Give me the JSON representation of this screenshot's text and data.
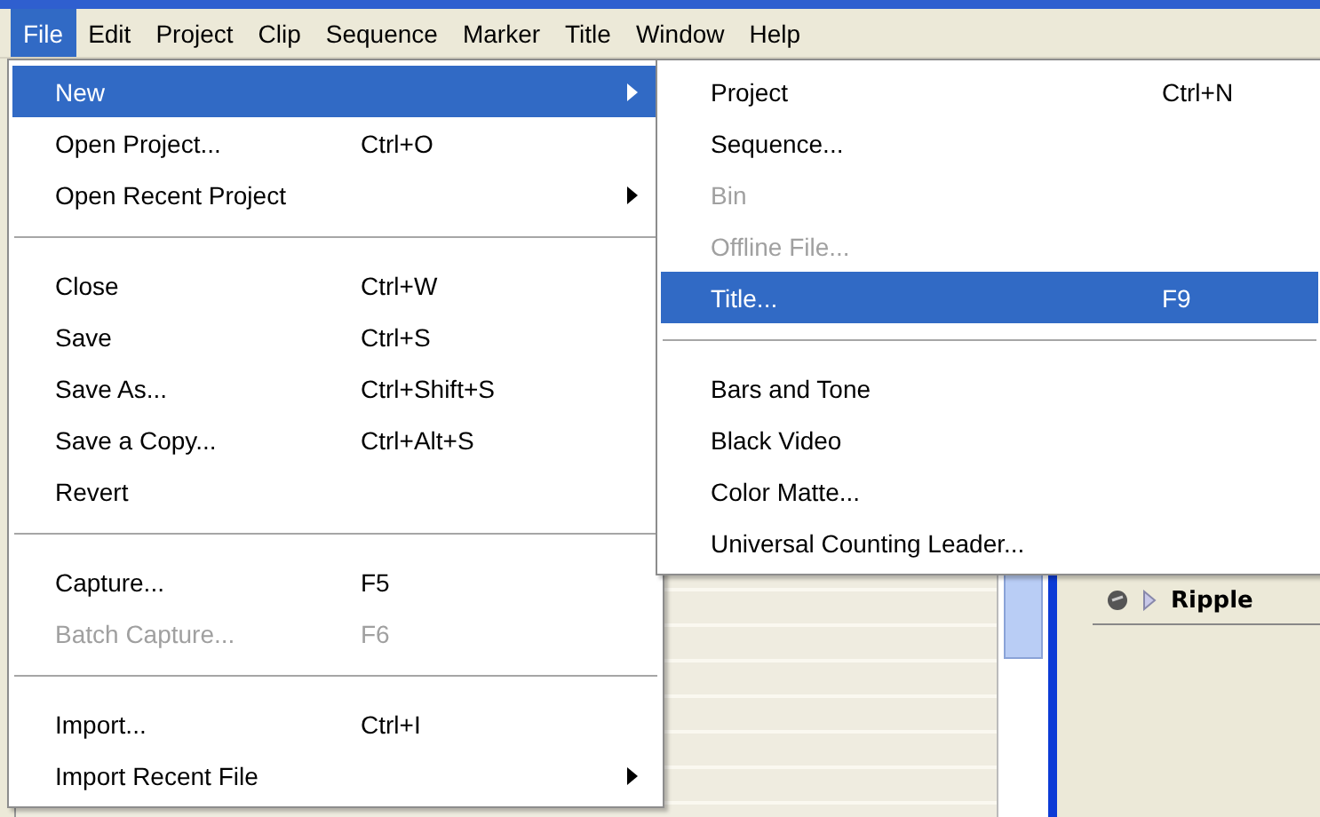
{
  "menu_bar": [
    {
      "label": "File",
      "selected": true
    },
    {
      "label": "Edit",
      "selected": false
    },
    {
      "label": "Project",
      "selected": false
    },
    {
      "label": "Clip",
      "selected": false
    },
    {
      "label": "Sequence",
      "selected": false
    },
    {
      "label": "Marker",
      "selected": false
    },
    {
      "label": "Title",
      "selected": false
    },
    {
      "label": "Window",
      "selected": false
    },
    {
      "label": "Help",
      "selected": false
    }
  ],
  "file_menu": [
    {
      "kind": "item",
      "label": "New",
      "submenu": true,
      "selected": true,
      "disabled": false
    },
    {
      "kind": "item",
      "label": "Open Project...",
      "shortcut": "Ctrl+O",
      "submenu": false,
      "selected": false,
      "disabled": false
    },
    {
      "kind": "item",
      "label": "Open Recent Project",
      "submenu": true,
      "selected": false,
      "disabled": false
    },
    {
      "kind": "separator"
    },
    {
      "kind": "item",
      "label": "Close",
      "shortcut": "Ctrl+W",
      "submenu": false,
      "selected": false,
      "disabled": false
    },
    {
      "kind": "item",
      "label": "Save",
      "shortcut": "Ctrl+S",
      "submenu": false,
      "selected": false,
      "disabled": false
    },
    {
      "kind": "item",
      "label": "Save As...",
      "shortcut": "Ctrl+Shift+S",
      "submenu": false,
      "selected": false,
      "disabled": false
    },
    {
      "kind": "item",
      "label": "Save a Copy...",
      "shortcut": "Ctrl+Alt+S",
      "submenu": false,
      "selected": false,
      "disabled": false
    },
    {
      "kind": "item",
      "label": "Revert",
      "submenu": false,
      "selected": false,
      "disabled": false
    },
    {
      "kind": "separator"
    },
    {
      "kind": "item",
      "label": "Capture...",
      "shortcut": "F5",
      "submenu": false,
      "selected": false,
      "disabled": false
    },
    {
      "kind": "item",
      "label": "Batch Capture...",
      "shortcut": "F6",
      "submenu": false,
      "selected": false,
      "disabled": true
    },
    {
      "kind": "separator"
    },
    {
      "kind": "item",
      "label": "Import...",
      "shortcut": "Ctrl+I",
      "submenu": false,
      "selected": false,
      "disabled": false
    },
    {
      "kind": "item",
      "label": "Import Recent File",
      "submenu": true,
      "selected": false,
      "disabled": false
    }
  ],
  "new_submenu": [
    {
      "kind": "item",
      "label": "Project",
      "shortcut": "Ctrl+N",
      "selected": false,
      "disabled": false
    },
    {
      "kind": "item",
      "label": "Sequence...",
      "selected": false,
      "disabled": false
    },
    {
      "kind": "item",
      "label": "Bin",
      "selected": false,
      "disabled": true
    },
    {
      "kind": "item",
      "label": "Offline File...",
      "selected": false,
      "disabled": true
    },
    {
      "kind": "item",
      "label": "Title...",
      "shortcut": "F9",
      "selected": true,
      "disabled": false
    },
    {
      "kind": "separator"
    },
    {
      "kind": "item",
      "label": "Bars and Tone",
      "selected": false,
      "disabled": false
    },
    {
      "kind": "item",
      "label": "Black Video",
      "selected": false,
      "disabled": false
    },
    {
      "kind": "item",
      "label": "Color Matte...",
      "selected": false,
      "disabled": false
    },
    {
      "kind": "item",
      "label": "Universal Counting Leader...",
      "selected": false,
      "disabled": false
    }
  ],
  "timeline": {
    "track_name": "Ripple"
  }
}
